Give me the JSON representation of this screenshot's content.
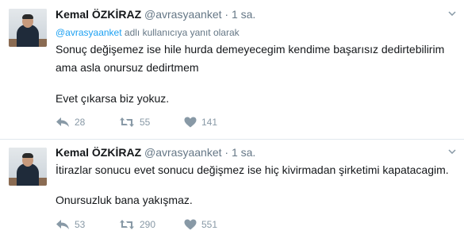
{
  "tweets": [
    {
      "name": "Kemal ÖZKİRAZ",
      "handle": "@avrasyaanket",
      "separator": "·",
      "time": "1 sa.",
      "reply_mention": "@avrasyaanket",
      "reply_suffix": "adlı kullanıcıya yanıt olarak",
      "lines": [
        "Sonuç değişemez ise hile hurda demeyecegim kendime başarısız dedirtebilirim",
        "ama asla onursuz dedirtmem",
        "Evet çıkarsa biz yokuz."
      ],
      "replies": "28",
      "retweets": "55",
      "likes": "141"
    },
    {
      "name": "Kemal ÖZKİRAZ",
      "handle": "@avrasyaanket",
      "separator": "·",
      "time": "1 sa.",
      "lines": [
        "İtirazlar sonucu evet sonucu değişmez ise hiç kivirmadan şirketimi kapatacagim.",
        "Onursuzluk bana yakışmaz."
      ],
      "replies": "53",
      "retweets": "290",
      "likes": "551"
    }
  ],
  "colors": {
    "text": "#14171a",
    "meta": "#657786",
    "mention": "#1da1f2",
    "action": "#8899a6",
    "divider": "#e1e8ed"
  },
  "icons": [
    "reply-icon",
    "retweet-icon",
    "heart-icon",
    "chevron-down-icon"
  ]
}
